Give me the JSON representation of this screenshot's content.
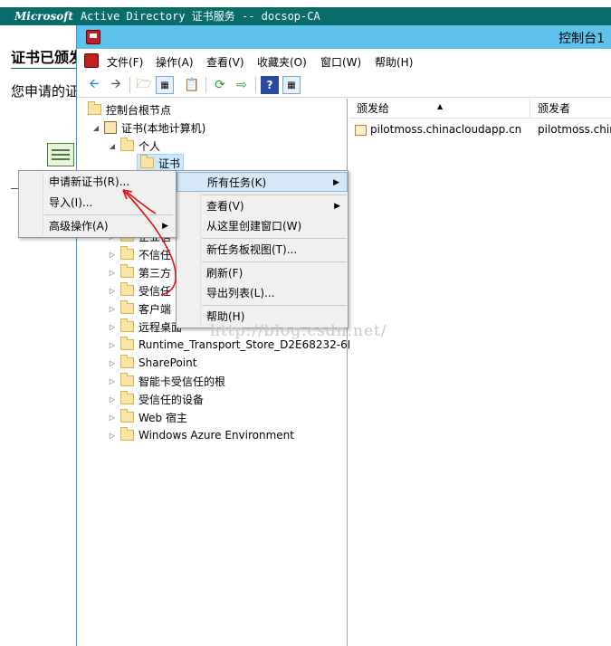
{
  "background_page": {
    "header_brand": "Microsoft",
    "header_text": "Active Directory 证书服务  --  docsop-CA",
    "heading": "证书已颁发",
    "body_text": "您申请的证"
  },
  "window": {
    "title": "控制台1"
  },
  "menubar": {
    "items": [
      "文件(F)",
      "操作(A)",
      "查看(V)",
      "收藏夹(O)",
      "窗口(W)",
      "帮助(H)"
    ]
  },
  "toolbar": {
    "buttons": [
      "back-icon",
      "forward-icon",
      "up-icon",
      "show-hide-tree-icon",
      "copy-icon",
      "refresh-icon",
      "export-icon",
      "help-icon",
      "show-action-pane-icon"
    ]
  },
  "tree": {
    "root": "控制台根节点",
    "certificates": "证书(本地计算机)",
    "personal": "个人",
    "certs": "证书",
    "nodes_hidden_partial": [
      "企业信",
      "不信任",
      "第三方",
      "受信任",
      "客户端",
      "远程桌面"
    ],
    "nodes": [
      "Runtime_Transport_Store_D2E68232-6F",
      "SharePoint",
      "智能卡受信任的根",
      "受信任的设备",
      "Web 宿主",
      "Windows Azure Environment"
    ]
  },
  "list": {
    "columns": [
      "颁发给",
      "颁发者"
    ],
    "rows": [
      {
        "issued_to": "pilotmoss.chinacloudapp.cn",
        "issued_by": "pilotmoss.chin"
      }
    ]
  },
  "context_menu_main": {
    "items": [
      "所有任务(K)",
      "查看(V)",
      "从这里创建窗口(W)",
      "新任务板视图(T)...",
      "刷新(F)",
      "导出列表(L)...",
      "帮助(H)"
    ]
  },
  "context_menu_sub": {
    "items": [
      "申请新证书(R)...",
      "导入(I)...",
      "高级操作(A)"
    ]
  },
  "watermark": "http://blog.csdn.net/",
  "colors": {
    "titlebar": "#5fc2ea",
    "header_bg": "#0a6b6b",
    "menu_hover": "#d5e8f8",
    "annotation": "#e01010"
  }
}
